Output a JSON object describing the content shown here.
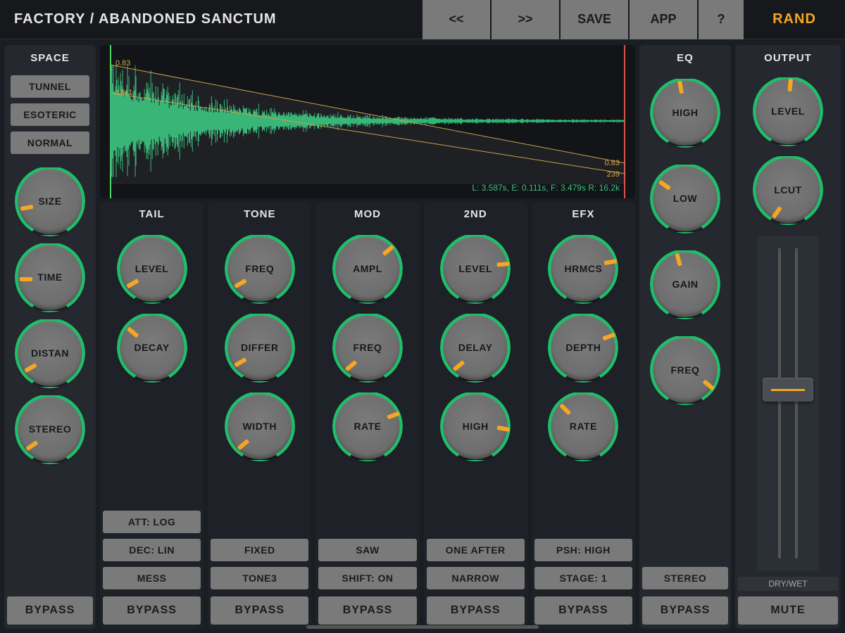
{
  "header": {
    "preset": "FACTORY / ABANDONED SANCTUM",
    "prev": "<<",
    "next": ">>",
    "save": "SAVE",
    "app": "APP",
    "help": "?",
    "rand": "RAND"
  },
  "space": {
    "title": "SPACE",
    "modes": [
      "TUNNEL",
      "ESOTERIC",
      "NORMAL"
    ],
    "knobs": [
      "SIZE",
      "TIME",
      "DISTAN",
      "STEREO"
    ],
    "bypass": "BYPASS"
  },
  "waveform": {
    "top_amp": "0.83",
    "freq": "1341",
    "end_amp": "0.83",
    "end_freq": "239",
    "status": "L: 3.587s, E: 0.111s, F: 3.479s R: 16.2k"
  },
  "sections": [
    {
      "title": "TAIL",
      "knobs": [
        "LEVEL",
        "DECAY"
      ],
      "buttons": [
        "ATT: LOG",
        "DEC: LIN",
        "MESS"
      ],
      "bypass": "BYPASS"
    },
    {
      "title": "TONE",
      "knobs": [
        "FREQ",
        "DIFFER",
        "WIDTH"
      ],
      "buttons": [
        "FIXED",
        "TONE3"
      ],
      "bypass": "BYPASS"
    },
    {
      "title": "MOD",
      "knobs": [
        "AMPL",
        "FREQ",
        "RATE"
      ],
      "buttons": [
        "SAW",
        "SHIFT: ON"
      ],
      "bypass": "BYPASS"
    },
    {
      "title": "2ND",
      "knobs": [
        "LEVEL",
        "DELAY",
        "HIGH"
      ],
      "buttons": [
        "ONE AFTER",
        "NARROW"
      ],
      "bypass": "BYPASS"
    },
    {
      "title": "EFX",
      "knobs": [
        "HRMCS",
        "DEPTH",
        "RATE"
      ],
      "buttons": [
        "PSH: HIGH",
        "STAGE: 1"
      ],
      "bypass": "BYPASS"
    }
  ],
  "eq": {
    "title": "EQ",
    "knobs": [
      "HIGH",
      "LOW",
      "GAIN",
      "FREQ"
    ],
    "stereo": "STEREO",
    "bypass": "BYPASS"
  },
  "output": {
    "title": "OUTPUT",
    "knobs": [
      "LEVEL",
      "LCUT"
    ],
    "drywet": "DRY/WET",
    "mute": "MUTE"
  },
  "knob_angles": {
    "space": [
      -100,
      -90,
      -120,
      -125
    ],
    "tail": [
      -120,
      -50
    ],
    "tone": [
      -120,
      -120,
      -130
    ],
    "mod": [
      50,
      -130,
      70
    ],
    "2nd": [
      85,
      -130,
      100
    ],
    "efx": [
      80,
      70,
      -45
    ],
    "eq": [
      -10,
      -55,
      -15,
      130
    ],
    "output": [
      5,
      -145
    ]
  },
  "fader_pos_pct": 46,
  "colors": {
    "accent": "#f5a623",
    "ring": "#1fbe6a",
    "bg": "#1a1d22",
    "panel": "#25282e",
    "panel_dark": "#1e2127",
    "button": "#7a7a7a"
  }
}
